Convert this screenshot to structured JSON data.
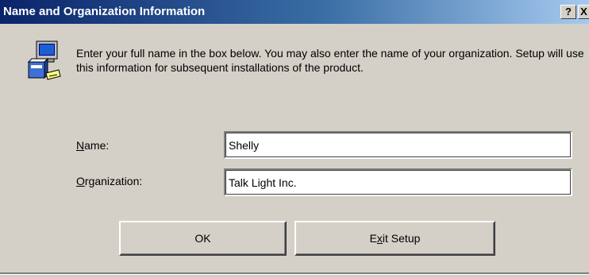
{
  "window": {
    "title": "Name and Organization Information",
    "help_label": "?",
    "close_label": "X"
  },
  "instructions": "Enter your full name in the box below. You may also enter the name of your organization. Setup will use this information for subsequent installations of the product.",
  "fields": {
    "name": {
      "mnemonic": "N",
      "rest": "ame:",
      "value": "Shelly"
    },
    "organization": {
      "mnemonic": "O",
      "rest": "rganization:",
      "value": "Talk Light Inc."
    }
  },
  "buttons": {
    "ok": "OK",
    "exit": {
      "pre": "E",
      "mnemonic": "x",
      "post": "it Setup"
    }
  },
  "icons": {
    "setup": "computer-setup-icon"
  },
  "colors": {
    "title_start": "#0a246a",
    "title_end": "#a6caf0",
    "face": "#d4d0c8"
  }
}
